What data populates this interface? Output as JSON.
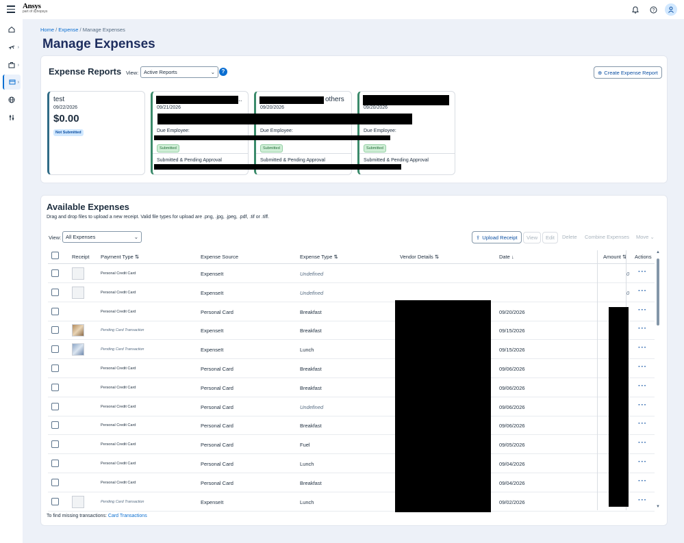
{
  "app": {
    "logo_text": "Ansys",
    "logo_sub": "part of synopsys",
    "menu_icon": "hamburger-icon"
  },
  "header": {
    "icons": [
      "bell-icon",
      "help-icon",
      "user-icon"
    ]
  },
  "nav": {
    "items": [
      {
        "icon": "home-icon"
      },
      {
        "icon": "travel-icon"
      },
      {
        "icon": "briefcase-icon"
      },
      {
        "icon": "expense-card-icon",
        "active": true
      },
      {
        "icon": "globe-icon"
      },
      {
        "icon": "settings-sliders-icon"
      }
    ]
  },
  "breadcrumb": {
    "home": "Home",
    "sep1": " / ",
    "expense": "Expense",
    "sep2": " / ",
    "current": "Manage Expenses"
  },
  "page": {
    "title": "Manage Expenses"
  },
  "reports": {
    "title": "Expense Reports",
    "view_label": "View:",
    "view_value": "Active Reports",
    "create_button": "Create Expense Report",
    "cards": [
      {
        "name": "test",
        "date": "09/22/2026",
        "amount": "$0.00",
        "status_badge": "Not Submitted"
      },
      {
        "name": "",
        "date": "09/21/2026",
        "due_label": "Due Employee:",
        "status_badge": "Submitted",
        "status_text": "Submitted & Pending Approval"
      },
      {
        "name": "others",
        "date": "09/20/2026",
        "due_label": "Due Employee:",
        "status_badge": "Submitted",
        "status_text": "Submitted & Pending Approval"
      },
      {
        "name": "",
        "date": "09/20/2026",
        "due_label": "Due Employee:",
        "status_badge": "Submitted",
        "status_text": "Submitted & Pending Approval"
      }
    ]
  },
  "expenses": {
    "title": "Available Expenses",
    "subtitle": "Drag and drop files to upload a new receipt. Valid file types for upload are .png, .jpg, .jpeg, .pdf, .tif or .tiff.",
    "view_label": "View:",
    "view_value": "All Expenses",
    "toolbar": {
      "upload": "Upload Receipt",
      "view": "View",
      "edit": "Edit",
      "delete": "Delete",
      "combine": "Combine Expenses",
      "move": "Move"
    },
    "columns": {
      "receipt": "Receipt",
      "payment_type": "Payment Type",
      "source": "Expense Source",
      "type": "Expense Type",
      "vendor": "Vendor Details",
      "date": "Date",
      "amount": "Amount",
      "actions": "Actions"
    },
    "rows": [
      {
        "receipt": "blank",
        "payment": "Personal Credit Card",
        "payment_italic": false,
        "source": "ExpenseIt",
        "type": "Undefined",
        "type_italic": true,
        "date": "",
        "amount": "0"
      },
      {
        "receipt": "blank",
        "payment": "Personal Credit Card",
        "payment_italic": false,
        "source": "ExpenseIt",
        "type": "Undefined",
        "type_italic": true,
        "date": "",
        "amount": "0"
      },
      {
        "receipt": "none",
        "payment": "Personal Credit Card",
        "payment_italic": false,
        "source": "Personal Card",
        "type": "Breakfast",
        "type_italic": false,
        "date": "09/20/2026",
        "amount": ""
      },
      {
        "receipt": "photo",
        "payment": "Pending Card Transaction",
        "payment_italic": true,
        "source": "ExpenseIt",
        "type": "Breakfast",
        "type_italic": false,
        "date": "09/15/2026",
        "amount": ""
      },
      {
        "receipt": "blue",
        "payment": "Pending Card Transaction",
        "payment_italic": true,
        "source": "ExpenseIt",
        "type": "Lunch",
        "type_italic": false,
        "date": "09/15/2026",
        "amount": ""
      },
      {
        "receipt": "none",
        "payment": "Personal Credit Card",
        "payment_italic": false,
        "source": "Personal Card",
        "type": "Breakfast",
        "type_italic": false,
        "date": "09/06/2026",
        "amount": ""
      },
      {
        "receipt": "none",
        "payment": "Personal Credit Card",
        "payment_italic": false,
        "source": "Personal Card",
        "type": "Breakfast",
        "type_italic": false,
        "date": "09/06/2026",
        "amount": ""
      },
      {
        "receipt": "none",
        "payment": "Personal Credit Card",
        "payment_italic": false,
        "source": "Personal Card",
        "type": "Undefined",
        "type_italic": true,
        "date": "09/06/2026",
        "amount": ""
      },
      {
        "receipt": "none",
        "payment": "Personal Credit Card",
        "payment_italic": false,
        "source": "Personal Card",
        "type": "Breakfast",
        "type_italic": false,
        "date": "09/06/2026",
        "amount": ""
      },
      {
        "receipt": "none",
        "payment": "Personal Credit Card",
        "payment_italic": false,
        "source": "Personal Card",
        "type": "Fuel",
        "type_italic": false,
        "date": "09/05/2026",
        "amount": ""
      },
      {
        "receipt": "none",
        "payment": "Personal Credit Card",
        "payment_italic": false,
        "source": "Personal Card",
        "type": "Lunch",
        "type_italic": false,
        "date": "09/04/2026",
        "amount": ""
      },
      {
        "receipt": "none",
        "payment": "Personal Credit Card",
        "payment_italic": false,
        "source": "Personal Card",
        "type": "Breakfast",
        "type_italic": false,
        "date": "09/04/2026",
        "amount": ""
      },
      {
        "receipt": "blank",
        "payment": "Pending Card Transaction",
        "payment_italic": true,
        "source": "ExpenseIt",
        "type": "Lunch",
        "type_italic": false,
        "date": "09/02/2026",
        "amount": ""
      }
    ],
    "footer_text": "To find missing transactions:",
    "footer_link": "Card Transactions"
  }
}
